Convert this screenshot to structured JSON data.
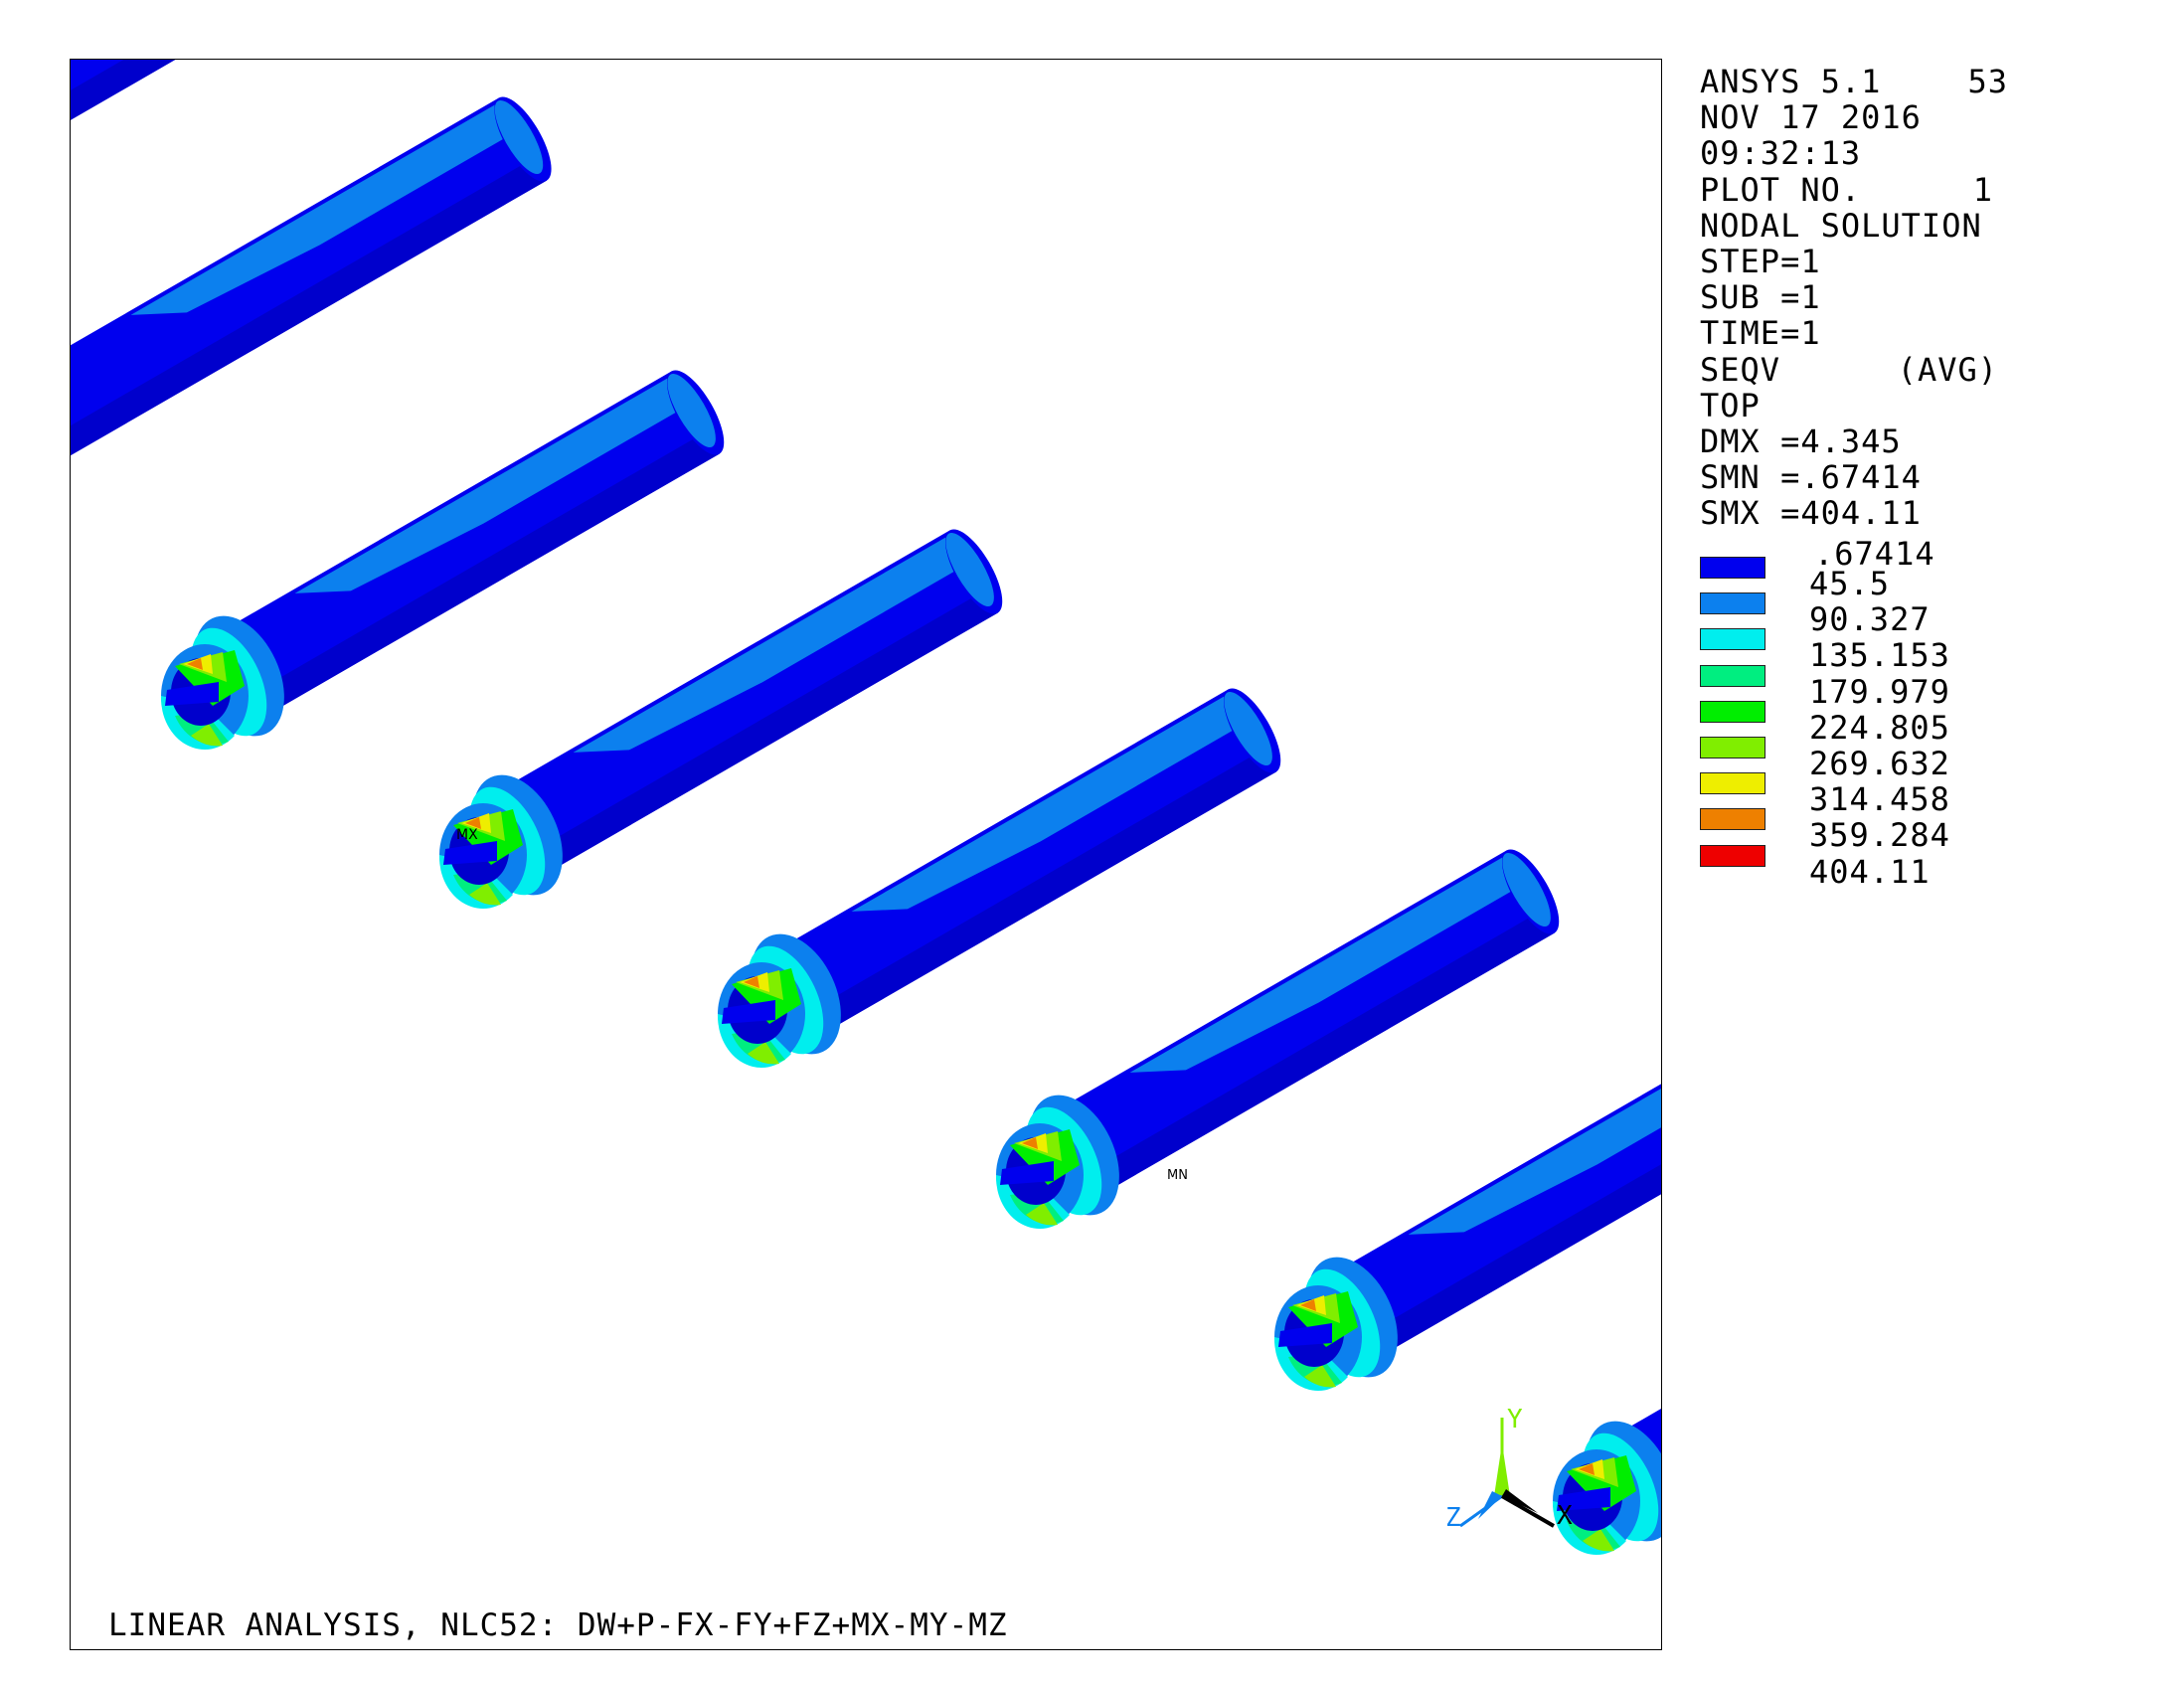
{
  "header": {
    "program": "ANSYS 5.1",
    "window_number": "53",
    "date": "NOV 17 2016",
    "time": "09:32:13",
    "plot_number_label": "PLOT NO.",
    "plot_number": "1"
  },
  "solution": {
    "type": "NODAL SOLUTION",
    "step": "STEP=1",
    "sub": "SUB =1",
    "time": "TIME=1",
    "quantity": "SEQV",
    "averaging": "(AVG)",
    "layer": "TOP",
    "dmx": "DMX =4.345",
    "smn": "SMN =.67414",
    "smx": "SMX =404.11"
  },
  "legend": {
    "min_value": ".67414",
    "bands": [
      {
        "value": "45.5",
        "color": "#0000ee"
      },
      {
        "value": "90.327",
        "color": "#0c80ee"
      },
      {
        "value": "135.153",
        "color": "#00eeee"
      },
      {
        "value": "179.979",
        "color": "#00ee80"
      },
      {
        "value": "224.805",
        "color": "#00ee00"
      },
      {
        "value": "269.632",
        "color": "#80ee00"
      },
      {
        "value": "314.458",
        "color": "#eeee00"
      },
      {
        "value": "359.284",
        "color": "#ee8000"
      },
      {
        "value": "404.11",
        "color": "#ee0000"
      }
    ]
  },
  "markers": {
    "max": "MX",
    "min": "MN"
  },
  "triad": {
    "x": "X",
    "y": "Y",
    "z": "Z",
    "x_color": "#000000",
    "y_color": "#80ee00",
    "z_color": "#0c80ee"
  },
  "footer": {
    "caption": "LINEAR ANALYSIS, NLC52: DW+P-FX-FY+FZ+MX-MY-MZ"
  }
}
